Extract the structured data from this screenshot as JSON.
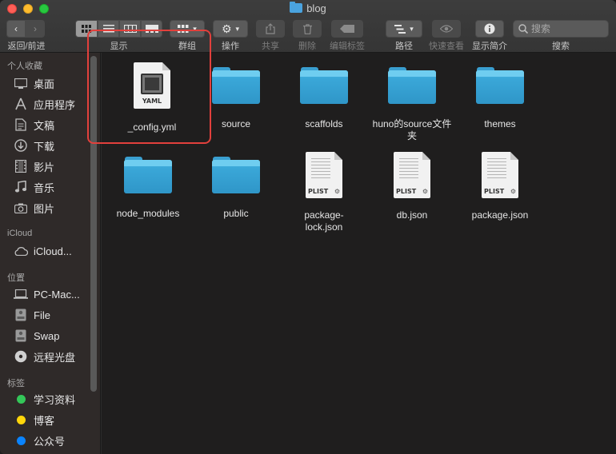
{
  "window": {
    "title": "blog"
  },
  "toolbar": {
    "nav_label": "返回/前进",
    "view_label": "显示",
    "group_label": "群组",
    "action_label": "操作",
    "share_label": "共享",
    "delete_label": "删除",
    "tags_label": "编辑标签",
    "path_label": "路径",
    "quicklook_label": "快速查看",
    "info_label": "显示简介",
    "search_label": "搜索",
    "search_placeholder": "搜索"
  },
  "sidebar": {
    "favorites_header": "个人收藏",
    "favorites": [
      {
        "label": "桌面",
        "icon": "desktop-icon"
      },
      {
        "label": "应用程序",
        "icon": "applications-icon"
      },
      {
        "label": "文稿",
        "icon": "documents-icon"
      },
      {
        "label": "下载",
        "icon": "downloads-icon"
      },
      {
        "label": "影片",
        "icon": "movies-icon"
      },
      {
        "label": "音乐",
        "icon": "music-icon"
      },
      {
        "label": "图片",
        "icon": "pictures-icon"
      }
    ],
    "icloud_header": "iCloud",
    "icloud": [
      {
        "label": "iCloud...",
        "icon": "cloud-icon"
      }
    ],
    "locations_header": "位置",
    "locations": [
      {
        "label": "PC-Mac...",
        "icon": "laptop-icon"
      },
      {
        "label": "File",
        "icon": "disk-icon"
      },
      {
        "label": "Swap",
        "icon": "disk-icon"
      },
      {
        "label": "远程光盘",
        "icon": "optical-disc-icon"
      }
    ],
    "tags_header": "标签",
    "tags": [
      {
        "label": "学习资料",
        "color": "#34c759"
      },
      {
        "label": "博客",
        "color": "#ffd60a"
      },
      {
        "label": "公众号",
        "color": "#0a84ff"
      }
    ]
  },
  "files": [
    {
      "name": "_config.yml",
      "kind": "yaml"
    },
    {
      "name": "source",
      "kind": "folder"
    },
    {
      "name": "scaffolds",
      "kind": "folder"
    },
    {
      "name": "huno的source文件夹",
      "kind": "folder"
    },
    {
      "name": "themes",
      "kind": "folder"
    },
    {
      "name": "node_modules",
      "kind": "folder"
    },
    {
      "name": "public",
      "kind": "folder"
    },
    {
      "name": "package-lock.json",
      "kind": "plist"
    },
    {
      "name": "db.json",
      "kind": "plist"
    },
    {
      "name": "package.json",
      "kind": "plist"
    }
  ],
  "icon_text": {
    "yaml": "YAML",
    "plist": "PLIST"
  }
}
